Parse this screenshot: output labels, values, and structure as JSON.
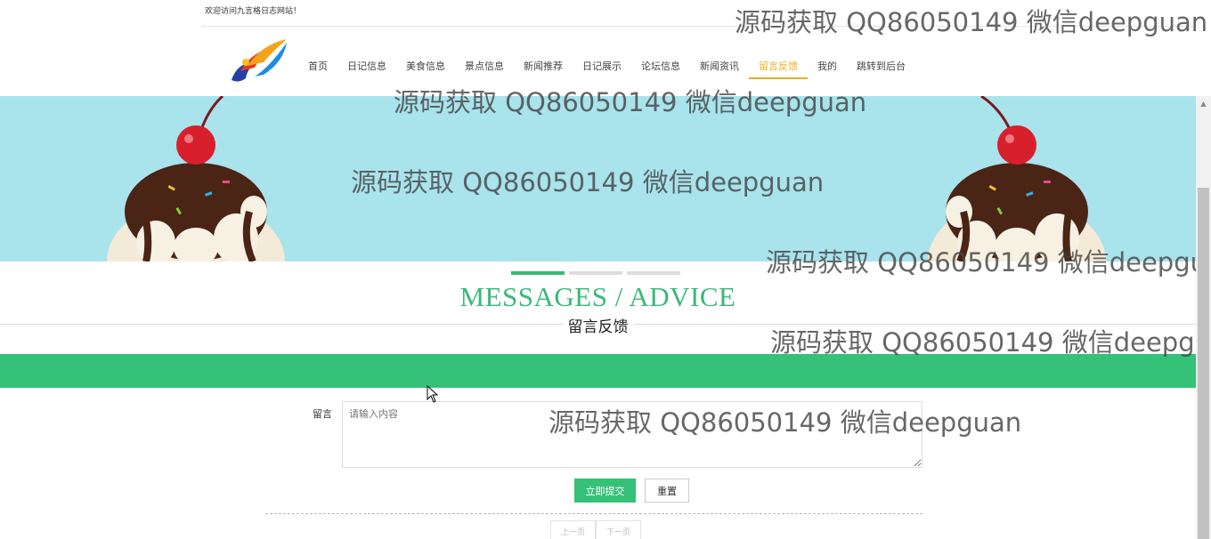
{
  "header": {
    "welcome": "欢迎访问九言格日志网站！"
  },
  "nav": {
    "items": [
      {
        "label": "首页",
        "active": false
      },
      {
        "label": "日记信息",
        "active": false
      },
      {
        "label": "美食信息",
        "active": false
      },
      {
        "label": "景点信息",
        "active": false
      },
      {
        "label": "新闻推荐",
        "active": false
      },
      {
        "label": "日记展示",
        "active": false
      },
      {
        "label": "论坛信息",
        "active": false
      },
      {
        "label": "新闻资讯",
        "active": false
      },
      {
        "label": "留言反馈",
        "active": true
      },
      {
        "label": "我的",
        "active": false
      },
      {
        "label": "跳转到后台",
        "active": false
      }
    ]
  },
  "carousel": {
    "slide_count": 3,
    "active_index": 0
  },
  "section": {
    "title": "MESSAGES / ADVICE",
    "subtitle": "留言反馈"
  },
  "form": {
    "label": "留言",
    "placeholder": "请输入内容",
    "submit_label": "立即提交",
    "reset_label": "重置"
  },
  "pager": {
    "prev_label": "上一页",
    "next_label": "下一页"
  },
  "watermark": {
    "text": "源码获取 QQ86050149 微信deepguan"
  },
  "colors": {
    "accent": "#35c178",
    "nav_active": "#e8b21c",
    "banner_bg": "#a9e3ec"
  }
}
